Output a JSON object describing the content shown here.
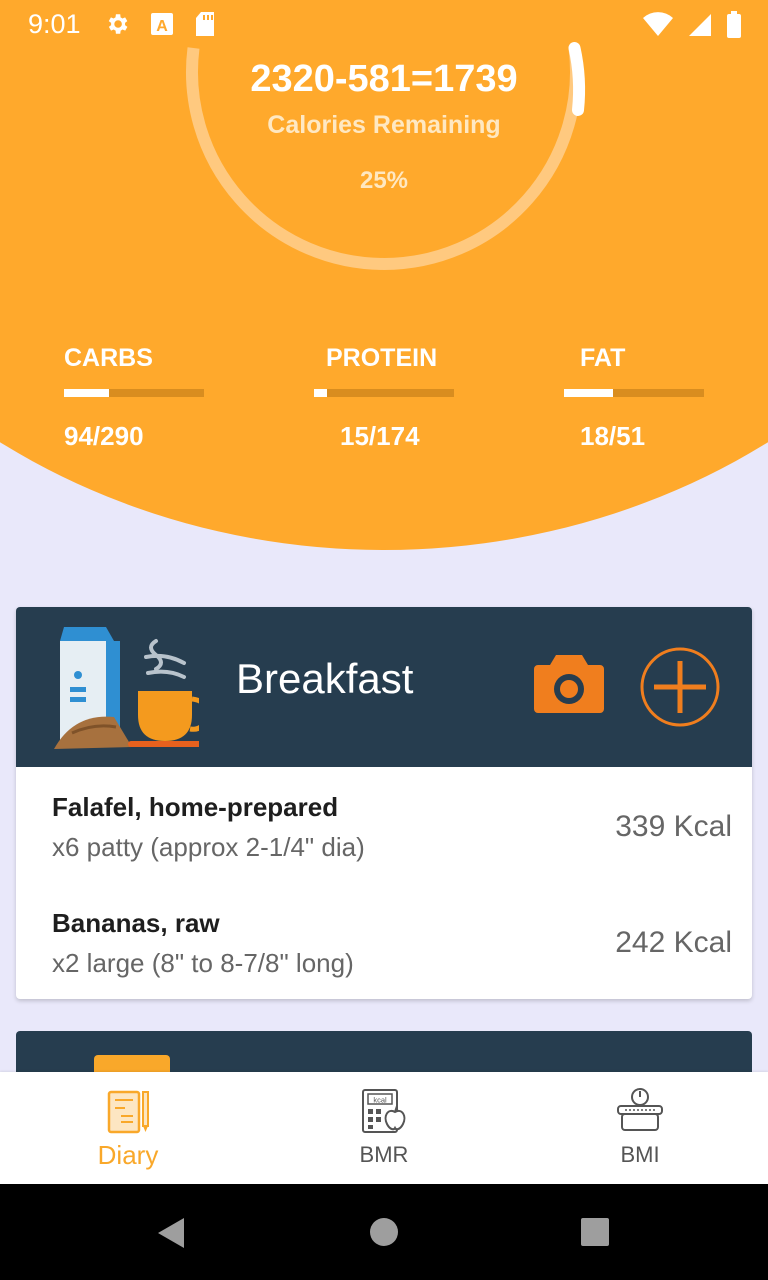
{
  "status_bar": {
    "time": "9:01"
  },
  "calories": {
    "equation": "2320-581=1739",
    "label": "Calories Remaining",
    "percent_text": "25%",
    "percent_value": 0.25
  },
  "macros": [
    {
      "label": "CARBS",
      "value": "94/290",
      "fraction": 0.32
    },
    {
      "label": "PROTEIN",
      "value": "15/174",
      "fraction": 0.09
    },
    {
      "label": "FAT",
      "value": "18/51",
      "fraction": 0.35
    }
  ],
  "meal": {
    "title": "Breakfast",
    "items": [
      {
        "name": "Falafel, home-prepared",
        "portion": "x6 patty (approx 2-1/4\" dia)",
        "kcal": "339 Kcal"
      },
      {
        "name": "Bananas, raw",
        "portion": "x2 large (8\" to 8-7/8\" long)",
        "kcal": "242 Kcal"
      }
    ]
  },
  "nav": {
    "items": [
      {
        "label": "Diary",
        "icon": "diary-icon",
        "active": true
      },
      {
        "label": "BMR",
        "icon": "calculator-icon",
        "active": false
      },
      {
        "label": "BMI",
        "icon": "scale-icon",
        "active": false
      }
    ]
  },
  "colors": {
    "accent": "#FFA92C",
    "card_header": "#263D4F",
    "camera": "#F07E1E",
    "nav_active": "#F9A82A"
  }
}
